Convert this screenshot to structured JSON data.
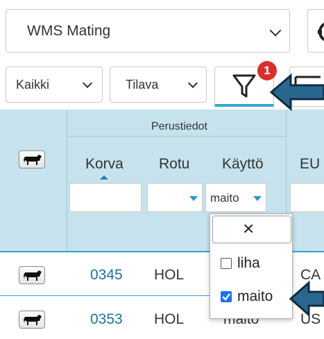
{
  "top_select": {
    "value": "WMS Mating"
  },
  "filter_bar": {
    "select1": "Kaikki",
    "select2": "Tilava",
    "filter_badge": "1"
  },
  "header": {
    "group": "Perustiedot",
    "columns": {
      "korva": "Korva",
      "rotu": "Rotu",
      "kaytto": "Käyttö",
      "eu": "EU"
    },
    "kaytto_filter_value": "maito"
  },
  "dropdown": {
    "close_symbol": "×",
    "options": [
      {
        "label": "liha",
        "checked": false
      },
      {
        "label": "maito",
        "checked": true
      }
    ]
  },
  "rows": [
    {
      "korva": "0345",
      "rotu": "HOL",
      "kaytto": "",
      "eu": "CA"
    },
    {
      "korva": "0353",
      "rotu": "HOL",
      "kaytto": "maito",
      "eu": "US"
    }
  ],
  "colors": {
    "accent": "#3aaac9",
    "header_bg": "#c6e3ed",
    "badge": "#d9302f",
    "arrow": "#1f4f6e"
  }
}
